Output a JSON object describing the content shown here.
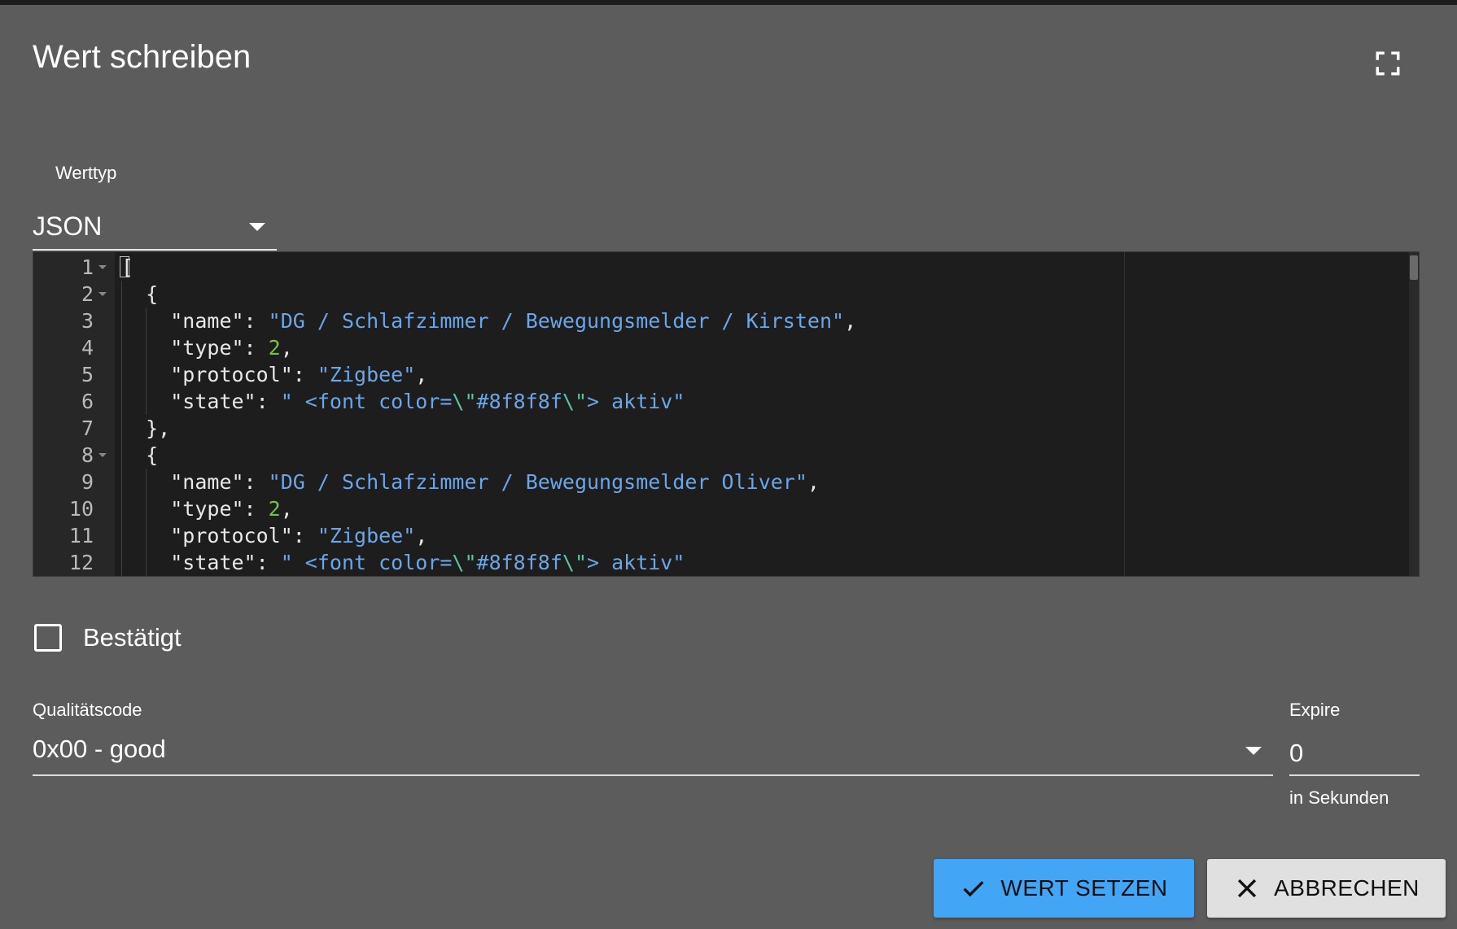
{
  "dialog": {
    "title": "Wert schreiben",
    "fullscreen_icon": "fullscreen-icon"
  },
  "value_type": {
    "label": "Werttyp",
    "selected": "JSON"
  },
  "editor": {
    "lines": [
      {
        "num": "1",
        "fold": true,
        "indent": 0,
        "tokens": [
          [
            "p",
            "["
          ]
        ]
      },
      {
        "num": "2",
        "fold": true,
        "indent": 1,
        "tokens": [
          [
            "p",
            "{"
          ]
        ]
      },
      {
        "num": "3",
        "fold": false,
        "indent": 2,
        "tokens": [
          [
            "k",
            "\"name\""
          ],
          [
            "p",
            ": "
          ],
          [
            "s",
            "\"DG / Schlafzimmer / Bewegungsmelder / Kirsten\""
          ],
          [
            "p",
            ","
          ]
        ]
      },
      {
        "num": "4",
        "fold": false,
        "indent": 2,
        "tokens": [
          [
            "k",
            "\"type\""
          ],
          [
            "p",
            ": "
          ],
          [
            "n",
            "2"
          ],
          [
            "p",
            ","
          ]
        ]
      },
      {
        "num": "5",
        "fold": false,
        "indent": 2,
        "tokens": [
          [
            "k",
            "\"protocol\""
          ],
          [
            "p",
            ": "
          ],
          [
            "s",
            "\"Zigbee\""
          ],
          [
            "p",
            ","
          ]
        ]
      },
      {
        "num": "6",
        "fold": false,
        "indent": 2,
        "tokens": [
          [
            "k",
            "\"state\""
          ],
          [
            "p",
            ": "
          ],
          [
            "s",
            "\" <font color="
          ],
          [
            "e",
            "\\\""
          ],
          [
            "s",
            "#8f8f8f"
          ],
          [
            "e",
            "\\\""
          ],
          [
            "s",
            "> aktiv\""
          ]
        ]
      },
      {
        "num": "7",
        "fold": false,
        "indent": 1,
        "tokens": [
          [
            "p",
            "},"
          ]
        ]
      },
      {
        "num": "8",
        "fold": true,
        "indent": 1,
        "tokens": [
          [
            "p",
            "{"
          ]
        ]
      },
      {
        "num": "9",
        "fold": false,
        "indent": 2,
        "tokens": [
          [
            "k",
            "\"name\""
          ],
          [
            "p",
            ": "
          ],
          [
            "s",
            "\"DG / Schlafzimmer / Bewegungsmelder Oliver\""
          ],
          [
            "p",
            ","
          ]
        ]
      },
      {
        "num": "10",
        "fold": false,
        "indent": 2,
        "tokens": [
          [
            "k",
            "\"type\""
          ],
          [
            "p",
            ": "
          ],
          [
            "n",
            "2"
          ],
          [
            "p",
            ","
          ]
        ]
      },
      {
        "num": "11",
        "fold": false,
        "indent": 2,
        "tokens": [
          [
            "k",
            "\"protocol\""
          ],
          [
            "p",
            ": "
          ],
          [
            "s",
            "\"Zigbee\""
          ],
          [
            "p",
            ","
          ]
        ]
      },
      {
        "num": "12",
        "fold": false,
        "indent": 2,
        "tokens": [
          [
            "k",
            "\"state\""
          ],
          [
            "p",
            ": "
          ],
          [
            "s",
            "\" <font color="
          ],
          [
            "e",
            "\\\""
          ],
          [
            "s",
            "#8f8f8f"
          ],
          [
            "e",
            "\\\""
          ],
          [
            "s",
            "> aktiv\""
          ]
        ]
      }
    ]
  },
  "acknowledged": {
    "label": "Bestätigt",
    "checked": false
  },
  "quality": {
    "label": "Qualitätscode",
    "selected": "0x00 - good"
  },
  "expire": {
    "label": "Expire",
    "value": "0",
    "helper": "in Sekunden"
  },
  "actions": {
    "set_label": "WERT SETZEN",
    "cancel_label": "ABBRECHEN"
  },
  "colors": {
    "background": "#5c5c5c",
    "editor_bg": "#1d1d1d",
    "primary": "#42a5f5",
    "string": "#6aa6e8",
    "number": "#74c24a"
  }
}
